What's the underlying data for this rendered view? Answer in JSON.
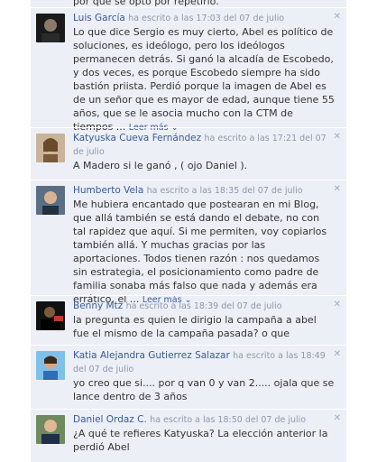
{
  "top_fragment": "por que se optó por repetirlo.",
  "more_label": "Leer más",
  "comments": [
    {
      "author": "Luis García",
      "meta": "ha escrito a las 17:03 del 07 de julio",
      "text": "Lo que dice Sergio es muy cierto, Abel es político de soluciones, es ideólogo, pero los ideólogos permanecen detrás. Si ganó la alcadía de Escobedo, y dos veces, es porque Escobedo siempre ha sido bastión priista. Perdió porque la imagen de Abel es de un señor que es mayor de edad, aunque tiene 55 años, que se le asocia mucho con la CTM de tiempos ...",
      "has_more": true
    },
    {
      "author": "Katyuska Cueva Fernández",
      "meta": "ha escrito a las 17:21 del 07 de julio",
      "text": "A Madero si le ganó , ( ojo Daniel ).",
      "has_more": false
    },
    {
      "author": "Humberto Vela",
      "meta": "ha escrito a las 18:35 del 07 de julio",
      "text": "Me hubiera encantado que postearan en mi Blog, que allá también se está dando el debate, no con tal rapidez que aquí. Si me permiten, voy copiarlos también allá. Y muchas gracias por las aportaciones. Todos tienen razón : nos quedamos sin estrategia, el posicionamiento como padre de familia sonaba más falso que nada y además era errático, el ...",
      "has_more": true
    },
    {
      "author": "Benny Mtz",
      "meta": "ha escrito a las 18:39 del 07 de julio",
      "text": "la pregunta es quien le dirigio la campaña a abel fue el mismo de la campaña pasada? o que",
      "has_more": false
    },
    {
      "author": "Katia Alejandra Gutierrez Salazar",
      "meta": "ha escrito a las 18:49 del 07 de julio",
      "text": "yo creo que si.... por q van 0 y van 2..... ojala que se lance dentro de 3 años",
      "has_more": false
    },
    {
      "author": "Daniel Ordaz C.",
      "meta": "ha escrito a las 18:50 del 07 de julio",
      "text": "¿A qué te refieres Katyuska? La elección anterior la perdió Abel",
      "has_more": false
    }
  ],
  "colors": {
    "link": "#3b5998",
    "meta": "#8e98ad",
    "background": "#eceff5",
    "close": "#a3abc2"
  },
  "icons": {
    "close": "close-icon",
    "more": "chevron-down-icon"
  }
}
